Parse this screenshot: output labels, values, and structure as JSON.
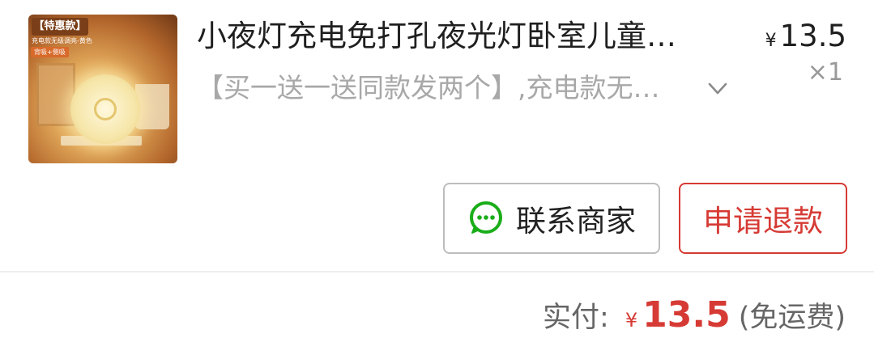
{
  "product": {
    "image": {
      "badge": "【特惠款】",
      "subtitle": "充电款无级调亮-黄色",
      "tag": "背吸+侧吸"
    },
    "title": "小夜灯充电免打孔夜光灯卧室儿童…",
    "currency_symbol": "¥",
    "price": "13.5",
    "quantity": "×1",
    "spec": "【买一送一送同款发两个】,充电款无…"
  },
  "actions": {
    "contact_label": "联系商家",
    "refund_label": "申请退款"
  },
  "summary": {
    "label": "实付:",
    "currency_symbol": "¥",
    "amount": "13.5",
    "note": "(免运费)"
  },
  "colors": {
    "accent": "#d63a34",
    "wechat_green": "#1aad19"
  },
  "icons": {
    "contact": "wechat-chat-icon",
    "expand": "chevron-down-icon"
  }
}
